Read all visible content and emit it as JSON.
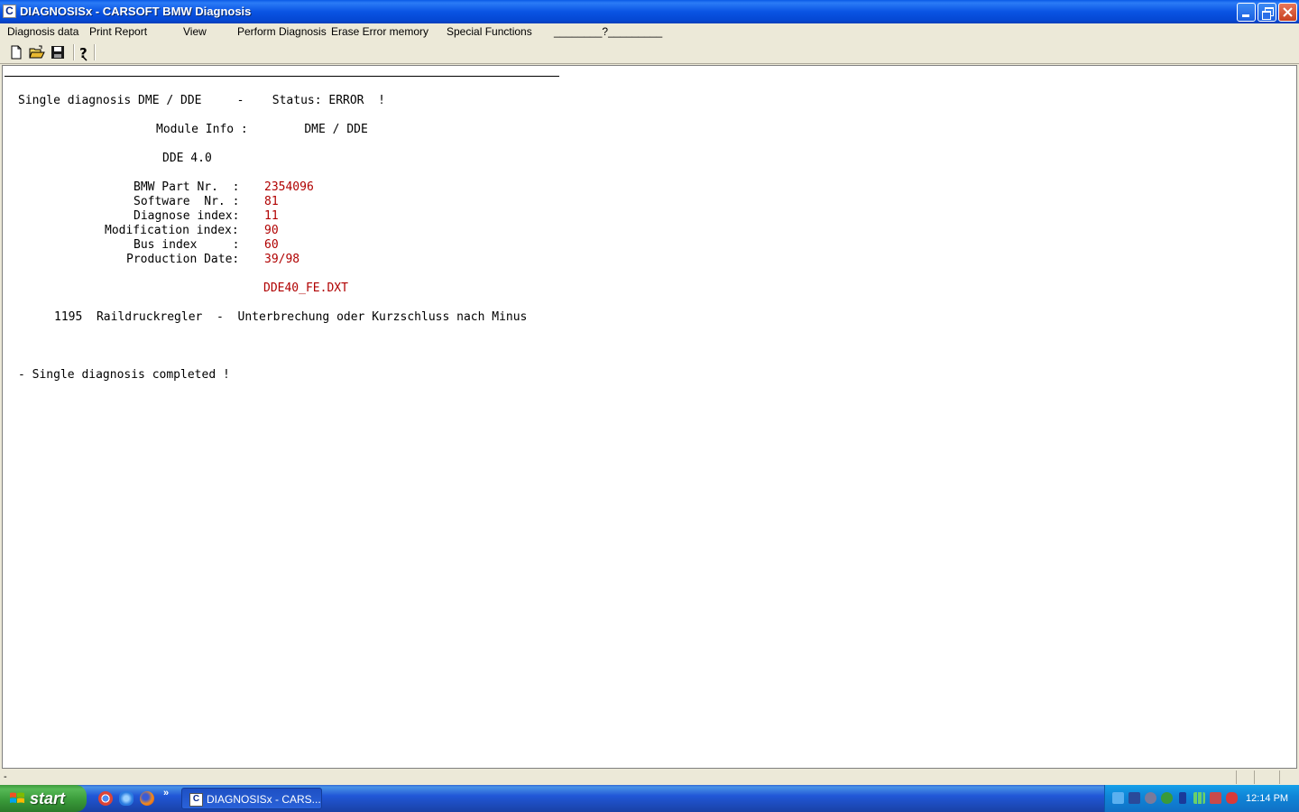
{
  "window": {
    "title": "DIAGNOSISx - CARSOFT BMW Diagnosis",
    "app_icon_letter": "C"
  },
  "menu": {
    "items": [
      "Diagnosis data",
      "Print Report",
      "View",
      "Perform Diagnosis",
      "Erase Error memory",
      "Special Functions"
    ],
    "help_label": "________?_________"
  },
  "toolbar": {
    "buttons": [
      "new-document-icon",
      "open-folder-icon",
      "save-disk-icon",
      "help-question-icon"
    ]
  },
  "report": {
    "header": "Single diagnosis DME / DDE     -    Status: ERROR  !",
    "module_info": "Module Info :        DME / DDE",
    "module_version": "DDE 4.0",
    "fields": [
      {
        "label": "BMW Part Nr.  :",
        "value": "2354096"
      },
      {
        "label": "Software  Nr. :",
        "value": "81"
      },
      {
        "label": "Diagnose index:",
        "value": "11"
      },
      {
        "label": "Modification index:",
        "value": "90"
      },
      {
        "label": "Bus index     :",
        "value": "60"
      },
      {
        "label": "Production Date:",
        "value": "39/98"
      }
    ],
    "file_name": "DDE40_FE.DXT",
    "error_line": "1195  Raildruckregler  -  Unterbrechung oder Kurzschluss nach Minus",
    "completion": "- Single diagnosis completed !"
  },
  "statusbar": {
    "text": "-"
  },
  "taskbar": {
    "start_label": "start",
    "quick_launch": [
      "chrome-icon",
      "internet-explorer-icon",
      "firefox-icon"
    ],
    "more_label": "»",
    "task_label": "DIAGNOSISx - CARS...",
    "clock": "12:14 PM"
  },
  "colors": {
    "value_red": "#b00000",
    "titlebar_blue": "#0a54e3",
    "taskbar_blue": "#2157d7",
    "start_green": "#3a9b3a"
  }
}
